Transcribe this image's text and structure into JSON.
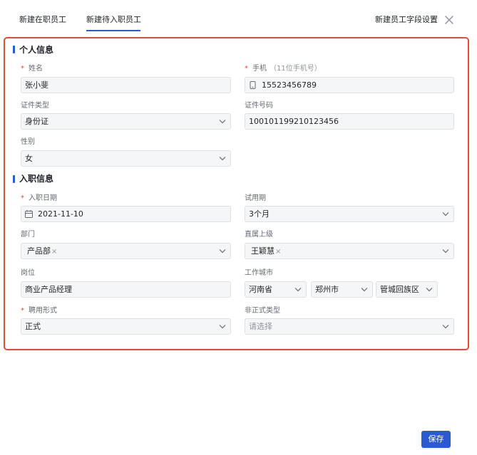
{
  "tabs": [
    {
      "label": "新建在职员工",
      "active": false
    },
    {
      "label": "新建待入职员工",
      "active": true
    }
  ],
  "header": {
    "field_settings": "新建员工字段设置",
    "close_icon": "close-icon"
  },
  "sections": {
    "personal": "个人信息",
    "onboarding": "入职信息"
  },
  "fields": {
    "name": {
      "label": "姓名",
      "required": "*",
      "value": "张小斐"
    },
    "phone": {
      "label": "手机",
      "hint": "（11位手机号）",
      "required": "*",
      "value": "15523456789",
      "icon": "phone-icon"
    },
    "id_type": {
      "label": "证件类型",
      "value": "身份证"
    },
    "id_number": {
      "label": "证件号码",
      "value": "100101199210123456"
    },
    "gender": {
      "label": "性别",
      "value": "女"
    },
    "start_date": {
      "label": "入职日期",
      "required": "*",
      "value": "2021-11-10",
      "icon": "calendar-icon"
    },
    "probation": {
      "label": "试用期",
      "value": "3个月"
    },
    "department": {
      "label": "部门",
      "tag": "产品部",
      "remove": "×"
    },
    "manager": {
      "label": "直属上级",
      "tag": "王颖慧",
      "remove": "×"
    },
    "position": {
      "label": "岗位",
      "value": "商业产品经理"
    },
    "city": {
      "label": "工作城市",
      "province": "河南省",
      "city": "郑州市",
      "district": "管城回族区"
    },
    "employment_type": {
      "label": "聘用形式",
      "required": "*",
      "value": "正式"
    },
    "informal_type": {
      "label": "非正式类型",
      "placeholder": "请选择"
    }
  },
  "footer": {
    "save_label": "保存"
  },
  "colors": {
    "accent": "#2a59d1",
    "highlight_border": "#e8473b",
    "required": "#e8473b"
  }
}
